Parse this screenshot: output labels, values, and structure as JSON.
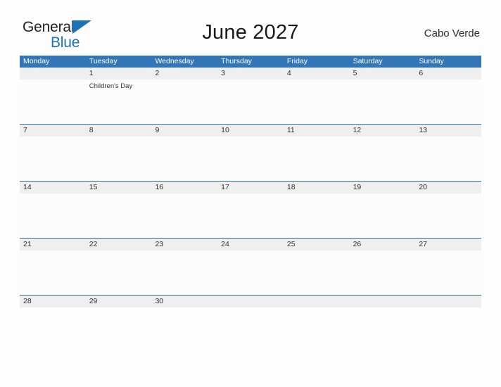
{
  "brand": {
    "word_general": "General",
    "word_blue": "Blue",
    "flag_icon": "triangle-flag-icon",
    "accent_color": "#1b72b8"
  },
  "header": {
    "title": "June 2027",
    "region": "Cabo Verde"
  },
  "theme": {
    "header_blue": "#3276b7",
    "separator_blue": "#2d6da3",
    "date_band_gray": "#efefef",
    "page_background": "#fdfdfe",
    "body_cell_background": "#fcfcfd",
    "title_color": "#1b1b1b"
  },
  "calendar": {
    "weekdays": [
      "Monday",
      "Tuesday",
      "Wednesday",
      "Thursday",
      "Friday",
      "Saturday",
      "Sunday"
    ],
    "weeks": [
      {
        "separator": false,
        "days": [
          {
            "date": "",
            "events": []
          },
          {
            "date": "1",
            "events": [
              "Children's Day"
            ]
          },
          {
            "date": "2",
            "events": []
          },
          {
            "date": "3",
            "events": []
          },
          {
            "date": "4",
            "events": []
          },
          {
            "date": "5",
            "events": []
          },
          {
            "date": "6",
            "events": []
          }
        ]
      },
      {
        "separator": true,
        "days": [
          {
            "date": "7",
            "events": []
          },
          {
            "date": "8",
            "events": []
          },
          {
            "date": "9",
            "events": []
          },
          {
            "date": "10",
            "events": []
          },
          {
            "date": "11",
            "events": []
          },
          {
            "date": "12",
            "events": []
          },
          {
            "date": "13",
            "events": []
          }
        ]
      },
      {
        "separator": true,
        "days": [
          {
            "date": "14",
            "events": []
          },
          {
            "date": "15",
            "events": []
          },
          {
            "date": "16",
            "events": []
          },
          {
            "date": "17",
            "events": []
          },
          {
            "date": "18",
            "events": []
          },
          {
            "date": "19",
            "events": []
          },
          {
            "date": "20",
            "events": []
          }
        ]
      },
      {
        "separator": true,
        "days": [
          {
            "date": "21",
            "events": []
          },
          {
            "date": "22",
            "events": []
          },
          {
            "date": "23",
            "events": []
          },
          {
            "date": "24",
            "events": []
          },
          {
            "date": "25",
            "events": []
          },
          {
            "date": "26",
            "events": []
          },
          {
            "date": "27",
            "events": []
          }
        ]
      },
      {
        "separator": true,
        "last": true,
        "days": [
          {
            "date": "28",
            "events": []
          },
          {
            "date": "29",
            "events": []
          },
          {
            "date": "30",
            "events": []
          },
          {
            "date": "",
            "events": []
          },
          {
            "date": "",
            "events": []
          },
          {
            "date": "",
            "events": []
          },
          {
            "date": "",
            "events": []
          }
        ]
      }
    ]
  }
}
